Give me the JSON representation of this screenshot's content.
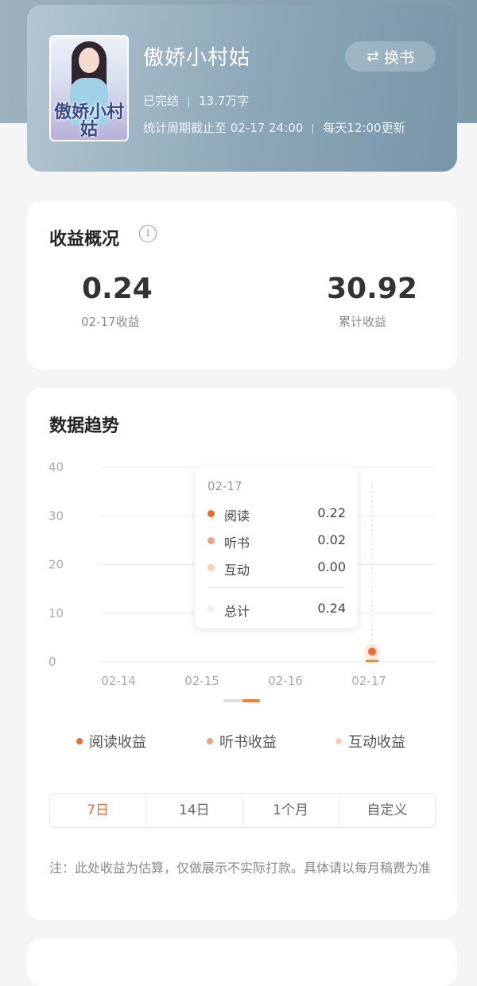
{
  "book": {
    "title": "傲娇小村姑",
    "status": "已完结",
    "word_count": "13.7万字",
    "stats_period": "统计周期截止至 02-17 24:00",
    "update_note": "每天12:00更新",
    "switch_label": "换书",
    "cover_title": "傲娇小村姑"
  },
  "earnings": {
    "title": "收益概况",
    "daily_value": "0.24",
    "daily_label": "02-17收益",
    "total_value": "30.92",
    "total_label": "累计收益"
  },
  "trend": {
    "title": "数据趋势",
    "tooltip": {
      "date": "02-17",
      "rows": [
        {
          "name": "阅读",
          "value": "0.22",
          "color": "#f06a2a"
        },
        {
          "name": "听书",
          "value": "0.02",
          "color": "#eda37d"
        },
        {
          "name": "互动",
          "value": "0.00",
          "color": "#f9cdb8"
        }
      ],
      "total_name": "总计",
      "total_value": "0.24",
      "total_color": "#f0f0f0"
    },
    "legend": [
      {
        "label": "阅读收益",
        "color": "#f06a2a"
      },
      {
        "label": "听书收益",
        "color": "#eda37d"
      },
      {
        "label": "互动收益",
        "color": "#f9cdb8"
      }
    ],
    "tabs": [
      "7日",
      "14日",
      "1个月",
      "自定义"
    ],
    "active_tab": "7日",
    "note": "注：此处收益为估算，仅做展示不实际打款。具体请以每月稿费为准"
  },
  "chart_data": {
    "type": "bar",
    "categories": [
      "02-14",
      "02-15",
      "02-16",
      "02-17"
    ],
    "series": [
      {
        "name": "阅读",
        "values": [
          0,
          0,
          0,
          0.22
        ]
      },
      {
        "name": "听书",
        "values": [
          0,
          0,
          0,
          0.02
        ]
      },
      {
        "name": "互动",
        "values": [
          0,
          0,
          0,
          0.0
        ]
      }
    ],
    "yticks": [
      0,
      10,
      20,
      30,
      40
    ],
    "ylim": [
      0,
      40
    ],
    "highlight_category": "02-17",
    "grid": true
  }
}
